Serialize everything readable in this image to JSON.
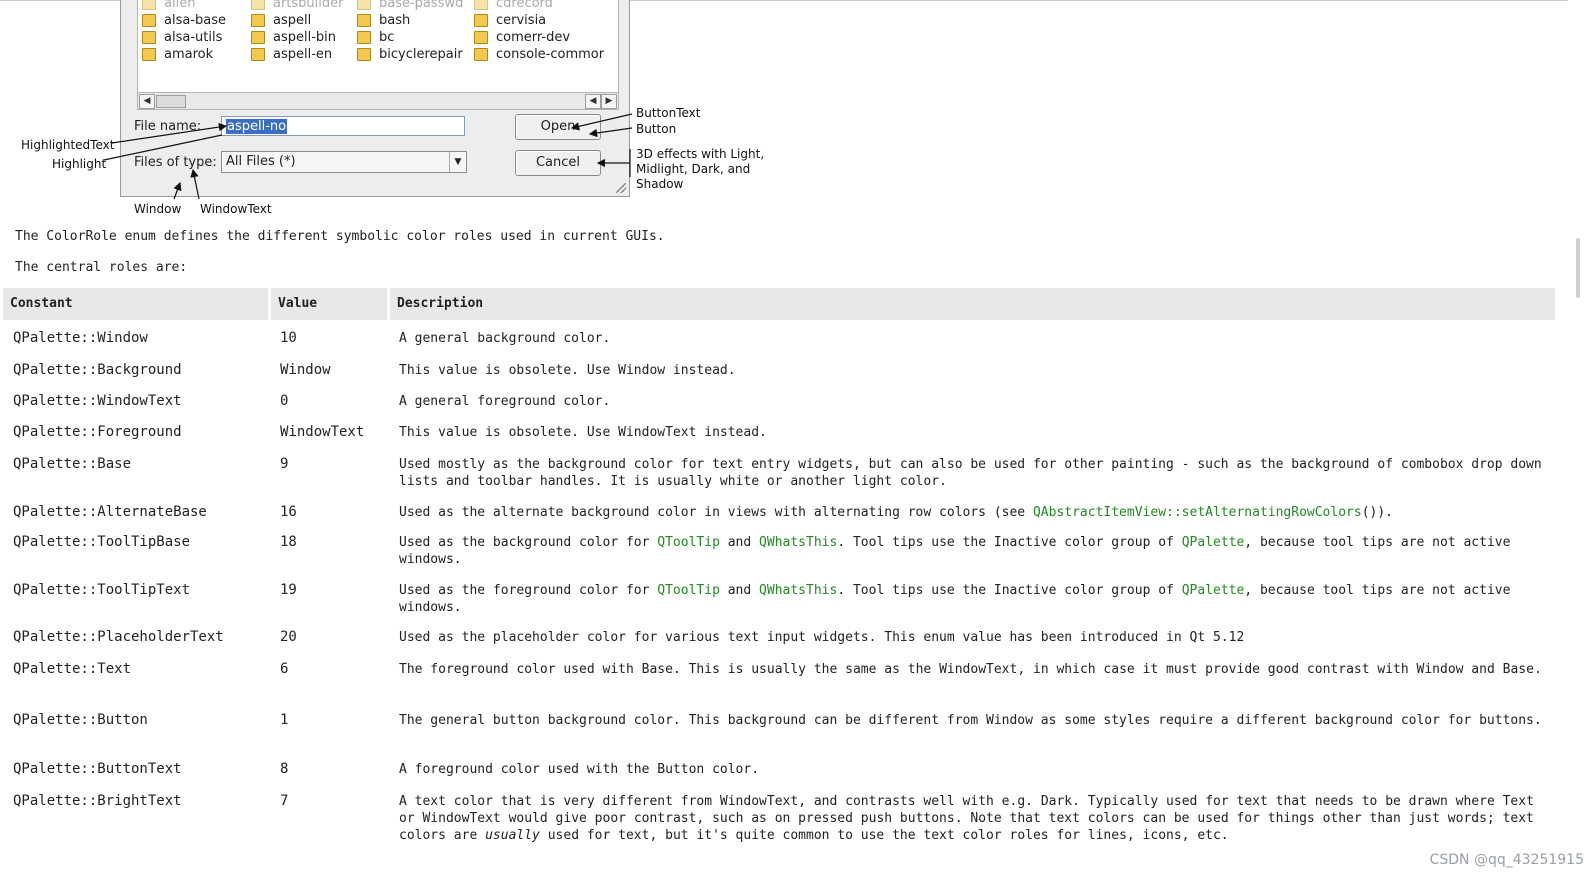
{
  "figure": {
    "file_columns": [
      [
        {
          "name": "allen",
          "faded": true
        },
        {
          "name": "alsa-base"
        },
        {
          "name": "alsa-utils"
        },
        {
          "name": "amarok"
        }
      ],
      [
        {
          "name": "artsbuilder",
          "faded": true
        },
        {
          "name": "aspell"
        },
        {
          "name": "aspell-bin"
        },
        {
          "name": "aspell-en"
        }
      ],
      [
        {
          "name": "base-passwd",
          "faded": true
        },
        {
          "name": "bash"
        },
        {
          "name": "bc"
        },
        {
          "name": "bicyclerepair"
        }
      ],
      [
        {
          "name": "cdrecord",
          "faded": true
        },
        {
          "name": "cervisia"
        },
        {
          "name": "comerr-dev"
        },
        {
          "name": "console-commor"
        }
      ]
    ],
    "file_name_label": "File name:",
    "file_name_value": "aspell-no",
    "files_of_type_label": "Files of type:",
    "files_of_type_value": "All Files (*)",
    "open_button": "Open",
    "cancel_button": "Cancel",
    "annotations": {
      "highlighted_text": "HighlightedText",
      "highlight": "Highlight",
      "window": "Window",
      "window_text": "WindowText",
      "button_text": "ButtonText",
      "button": "Button",
      "effects": "3D effects with Light, Midlight, Dark, and Shadow"
    }
  },
  "intro": "The ColorRole enum defines the different symbolic color roles used in current GUIs.",
  "central": "The central roles are:",
  "table": {
    "headers": [
      "Constant",
      "Value",
      "Description"
    ],
    "rows": [
      {
        "constant": "QPalette::Window",
        "value": "10",
        "desc": [
          {
            "t": "A general background color."
          }
        ]
      },
      {
        "constant": "QPalette::Background",
        "value": "Window",
        "desc": [
          {
            "t": "This value is obsolete. Use Window instead."
          }
        ]
      },
      {
        "constant": "QPalette::WindowText",
        "value": "0",
        "desc": [
          {
            "t": "A general foreground color."
          }
        ]
      },
      {
        "constant": "QPalette::Foreground",
        "value": "WindowText",
        "desc": [
          {
            "t": "This value is obsolete. Use WindowText instead."
          }
        ]
      },
      {
        "constant": "QPalette::Base",
        "value": "9",
        "desc": [
          {
            "t": "Used mostly as the background color for text entry widgets, but can also be used for other painting - such as the background of combobox drop down lists and toolbar handles. It is usually white or another light color."
          }
        ]
      },
      {
        "constant": "QPalette::AlternateBase",
        "value": "16",
        "desc": [
          {
            "t": "Used as the alternate background color in views with alternating row colors (see "
          },
          {
            "t": "QAbstractItemView::setAlternatingRowColors",
            "link": true
          },
          {
            "t": "())."
          }
        ]
      },
      {
        "constant": "QPalette::ToolTipBase",
        "value": "18",
        "desc": [
          {
            "t": "Used as the background color for "
          },
          {
            "t": "QToolTip",
            "link": true
          },
          {
            "t": " and "
          },
          {
            "t": "QWhatsThis",
            "link": true
          },
          {
            "t": ". Tool tips use the Inactive color group of "
          },
          {
            "t": "QPalette",
            "link": true
          },
          {
            "t": ", because tool tips are not active windows."
          }
        ]
      },
      {
        "constant": "QPalette::ToolTipText",
        "value": "19",
        "desc": [
          {
            "t": "Used as the foreground color for "
          },
          {
            "t": "QToolTip",
            "link": true
          },
          {
            "t": " and "
          },
          {
            "t": "QWhatsThis",
            "link": true
          },
          {
            "t": ". Tool tips use the Inactive color group of "
          },
          {
            "t": "QPalette",
            "link": true
          },
          {
            "t": ", because tool tips are not active windows."
          }
        ]
      },
      {
        "constant": "QPalette::PlaceholderText",
        "value": "20",
        "desc": [
          {
            "t": "Used as the placeholder color for various text input widgets. This enum value has been introduced in Qt 5.12"
          }
        ]
      },
      {
        "constant": "QPalette::Text",
        "value": "6",
        "desc": [
          {
            "t": "The foreground color used with "
          },
          {
            "t": "Base",
            "code": true
          },
          {
            "t": ". This is usually the same as the "
          },
          {
            "t": "WindowText",
            "code": true
          },
          {
            "t": ", in which case it must provide good contrast with "
          },
          {
            "t": "Window",
            "code": true
          },
          {
            "t": " and "
          },
          {
            "t": "Base",
            "code": true
          },
          {
            "t": "."
          }
        ]
      },
      {
        "constant": "QPalette::Button",
        "value": "1",
        "desc": [
          {
            "t": "The general button background color. This background can be different from "
          },
          {
            "t": "Window",
            "code": true
          },
          {
            "t": " as some styles require a different background color for buttons."
          }
        ]
      },
      {
        "constant": "QPalette::ButtonText",
        "value": "8",
        "desc": [
          {
            "t": "A foreground color used with the "
          },
          {
            "t": "Button",
            "code": true
          },
          {
            "t": " color."
          }
        ]
      },
      {
        "constant": "QPalette::BrightText",
        "value": "7",
        "desc": [
          {
            "t": "A text color that is very different from "
          },
          {
            "t": "WindowText",
            "code": true
          },
          {
            "t": ", and contrasts well with e.g. "
          },
          {
            "t": "Dark",
            "code": true
          },
          {
            "t": ". Typically used for text that needs to be drawn where "
          },
          {
            "t": "Text",
            "code": true
          },
          {
            "t": " or "
          },
          {
            "t": "WindowText",
            "code": true
          },
          {
            "t": " would give poor contrast, such as on pressed push buttons. Note that text colors can be used for things other than just words; text colors are "
          },
          {
            "t": "usually",
            "em": true
          },
          {
            "t": " used for text, but it's quite common to use the text color roles for lines, icons, etc."
          }
        ]
      }
    ]
  },
  "watermark": "CSDN @qq_43251915",
  "colors": {
    "link": "#218b21",
    "header_bg": "#e8e8e8",
    "selection": "#3d6fc1"
  }
}
